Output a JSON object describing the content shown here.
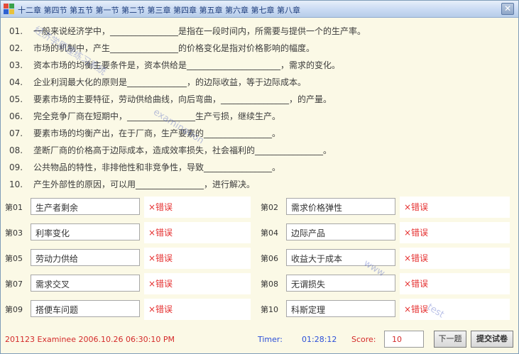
{
  "window": {
    "title": "十二章 第四节 第五节 第一节 第二节 第三章 第四章 第五章 第六章 第七章 第八章"
  },
  "questions": [
    {
      "num": "01.",
      "text": "一般来说经济学中，________________是指在一段时间内，所需要与提供一个的生产率。"
    },
    {
      "num": "02.",
      "text": "市场的机制中，产生________________的价格变化是指对价格影响的幅度。"
    },
    {
      "num": "03.",
      "text": "资本市场的均衡主要条件是，资本供给是______________________，需求的变化。"
    },
    {
      "num": "04.",
      "text": "企业利润最大化的原则是______________，的边际收益，等于边际成本。"
    },
    {
      "num": "05.",
      "text": "要素市场的主要特征，劳动供给曲线，向后弯曲，________________，的产量。"
    },
    {
      "num": "06.",
      "text": "完全竞争厂商在短期中，________________生产亏损，继续生产。"
    },
    {
      "num": "07.",
      "text": "要素市场的均衡产出，在于厂商，生产要素的________________。"
    },
    {
      "num": "08.",
      "text": "垄断厂商的价格高于边际成本，造成效率损失，社会福利的________________。"
    },
    {
      "num": "09.",
      "text": "公共物品的特性，非排他性和非竞争性，导致________________。"
    },
    {
      "num": "10.",
      "text": "产生外部性的原因，可以用________________，进行解决。"
    }
  ],
  "answers": [
    {
      "label": "第01",
      "value": "生产者剩余",
      "status": "×错误"
    },
    {
      "label": "第02",
      "value": "需求价格弹性",
      "status": "×错误"
    },
    {
      "label": "第03",
      "value": "利率变化",
      "status": "×错误"
    },
    {
      "label": "第04",
      "value": "边际产品",
      "status": "×错误"
    },
    {
      "label": "第05",
      "value": "劳动力供给",
      "status": "×错误"
    },
    {
      "label": "第06",
      "value": "收益大于成本",
      "status": "×错误"
    },
    {
      "label": "第07",
      "value": "需求交叉",
      "status": "×错误"
    },
    {
      "label": "第08",
      "value": "无谓损失",
      "status": "×错误"
    },
    {
      "label": "第09",
      "value": "搭便车问题",
      "status": "×错误"
    },
    {
      "label": "第10",
      "value": "科斯定理",
      "status": "×错误"
    }
  ],
  "status_bar": {
    "user_line": "201123 Examinee 2006.10.26 06:30:10 PM",
    "timer_label": "Timer:",
    "timer_value": "01:28:12",
    "score_label": "Score:",
    "score_value": "10",
    "button1_label": "下一题",
    "button2_label": "提交试卷"
  },
  "colors": {
    "window_bg": "#fbf9e6",
    "error_text": "#e53030",
    "accent_blue": "#2b4fd8",
    "watermark": "#3c50be"
  },
  "watermarks": [
    "经济学原理练习系统",
    "examination",
    "www",
    "test"
  ]
}
